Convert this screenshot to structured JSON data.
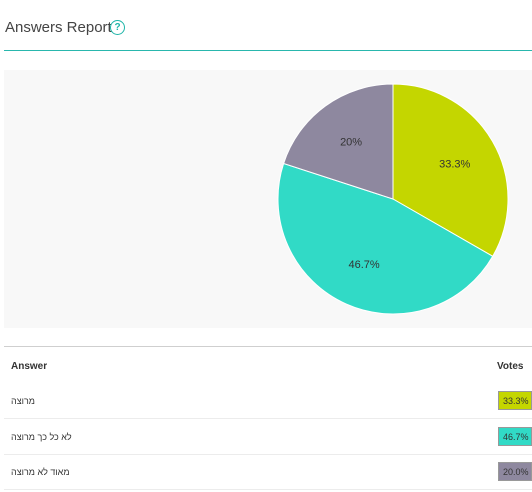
{
  "header": {
    "title": "Answers Report",
    "help_icon": "help-circle-icon",
    "help_glyph": "?"
  },
  "colors": {
    "accent": "#29b7ad"
  },
  "chart_data": {
    "type": "pie",
    "slices": [
      {
        "label": "מרוצה",
        "value": 33.3,
        "display": "33.3%",
        "color": "#c4d600"
      },
      {
        "label": "לא כל כך מרוצה",
        "value": 46.7,
        "display": "46.7%",
        "color": "#31dac6"
      },
      {
        "label": "מאוד לא מרוצה",
        "value": 20.0,
        "display": "20%",
        "color": "#8e889f"
      }
    ]
  },
  "table": {
    "headers": {
      "answer": "Answer",
      "votes": "Votes"
    },
    "rows": [
      {
        "answer": "מרוצה",
        "votes": "33.3%",
        "color": "#c4d600"
      },
      {
        "answer": "לא כל כך מרוצה",
        "votes": "46.7%",
        "color": "#31dac6"
      },
      {
        "answer": "מאוד לא מרוצה",
        "votes": "20.0%",
        "color": "#8e889f"
      }
    ]
  }
}
